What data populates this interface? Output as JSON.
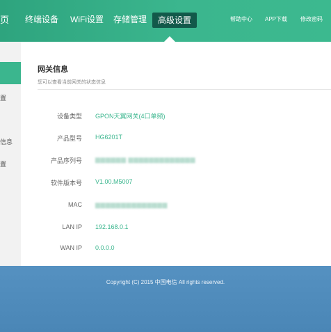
{
  "header": {
    "brand_fragment": "页",
    "nav": [
      "终端设备",
      "WiFi设置",
      "存储管理",
      "高级设置"
    ],
    "active_nav": "高级设置",
    "links": [
      "帮助中心",
      "APP下载",
      "修改密码"
    ],
    "colors": {
      "header_green": "#3bb68e",
      "active_tab": "#12594a"
    }
  },
  "sidebar": {
    "items": [
      "",
      "",
      "置",
      "",
      "信息",
      "置"
    ]
  },
  "panel": {
    "title": "网关信息",
    "subtitle": "您可以查看当前网关的状态信息",
    "rows": [
      {
        "label": "设备类型",
        "value": "GPON天翼网关(4口单频)"
      },
      {
        "label": "产品型号",
        "value": "HG6201T"
      },
      {
        "label": "产品序列号",
        "value": "[redacted]"
      },
      {
        "label": "软件版本号",
        "value": "V1.00.M5007"
      },
      {
        "label": "MAC",
        "value": "[redacted]"
      },
      {
        "label": "LAN IP",
        "value": "192.168.0.1"
      },
      {
        "label": "WAN IP",
        "value": "0.0.0.0"
      }
    ],
    "value_color": "#3bb68e"
  },
  "footer": {
    "copyright": "Copyright (C) 2015 中国电信 All rights reserved."
  }
}
